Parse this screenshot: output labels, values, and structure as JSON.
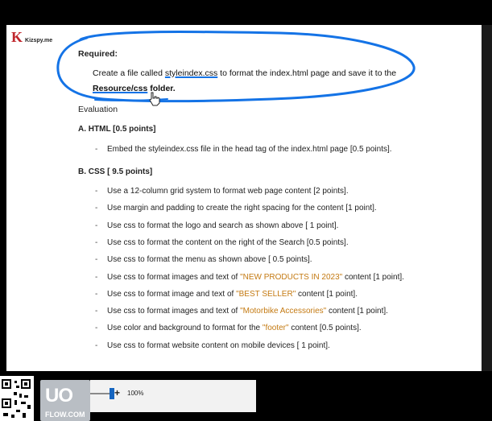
{
  "logo": {
    "mark": "K",
    "text": "Kizspy.me"
  },
  "required": {
    "heading": "Required:",
    "line1_pre": "Create a file called ",
    "line1_file": "styleindex.css",
    "line1_post": " to format the index.html page and save it to the",
    "line2_folder": "Resource/css",
    "line2_post": " folder."
  },
  "evaluation": {
    "heading": "Evaluation"
  },
  "section_a": {
    "heading": "A. HTML  [0.5 points]",
    "items": [
      "Embed the styleindex.css file in the head tag of the index.html page [0.5 points]."
    ]
  },
  "section_b": {
    "heading": "B. CSS  [ 9.5 points]",
    "items": [
      {
        "pre": "Use a 12-column grid system to format web page content [2 points].",
        "hl": "",
        "post": ""
      },
      {
        "pre": "Use margin and padding to create the right spacing for the content [1 point].",
        "hl": "",
        "post": ""
      },
      {
        "pre": "Use css to format the logo and search as shown above [ 1 point].",
        "hl": "",
        "post": ""
      },
      {
        "pre": "Use css to format the content on the right of the Search  [0.5 points].",
        "hl": "",
        "post": ""
      },
      {
        "pre": "Use css to format the menu as shown above [ 0.5 points].",
        "hl": "",
        "post": ""
      },
      {
        "pre": "Use css to format images and text of  ",
        "hl": "\"NEW PRODUCTS IN 2023\"",
        "post": "  content [1 point]."
      },
      {
        "pre": "Use css  to format image and text of ",
        "hl": "\"BEST SELLER\"",
        "post": " content [1 point]."
      },
      {
        "pre": "Use css  to format images and text of  ",
        "hl": "\"Motorbike Accessories\"",
        "post": " content [1 point]."
      },
      {
        "pre": "Use color and background  to format for the ",
        "hl": "\"footer\"",
        "post": " content [0.5 points]."
      },
      {
        "pre": "Use css to format website content on mobile devices [ 1 point].",
        "hl": "",
        "post": ""
      }
    ]
  },
  "bottom": {
    "brand_logo": "UO",
    "brand_sub": "FLOW.COM",
    "zoom_plus": "+",
    "zoom_label": "100%",
    "zoom_level_percent": 100
  },
  "colors": {
    "annotation": "#1473e6",
    "highlight_text": "#c47a12",
    "logo_mark": "#c0272d"
  }
}
